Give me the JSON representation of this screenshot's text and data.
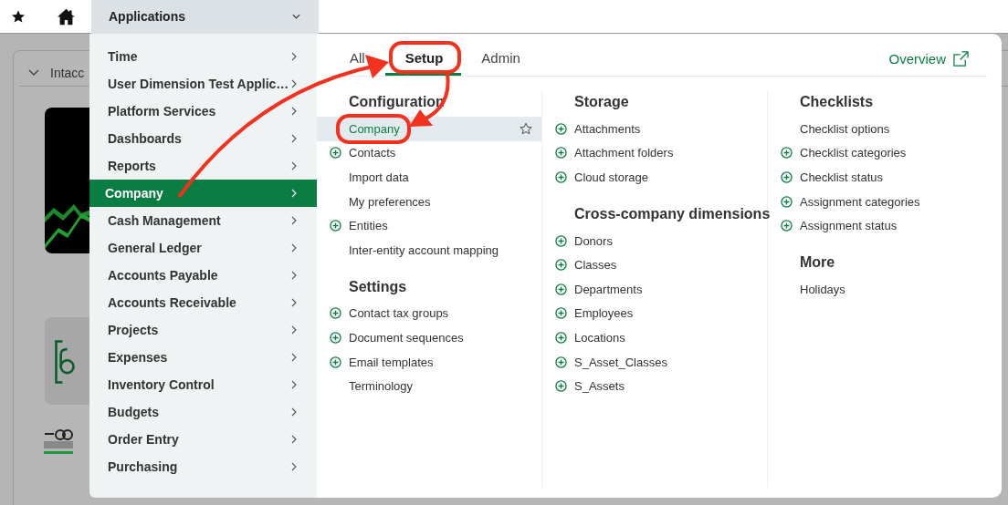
{
  "topbar": {
    "app_menu": "Applications"
  },
  "background": {
    "card_title": "Intacc"
  },
  "app_menu": [
    {
      "label": "Time",
      "selected": false
    },
    {
      "label": "User Dimension Test Applic…",
      "selected": false
    },
    {
      "label": "Platform Services",
      "selected": false
    },
    {
      "label": "Dashboards",
      "selected": false
    },
    {
      "label": "Reports",
      "selected": false
    },
    {
      "label": "Company",
      "selected": true
    },
    {
      "label": "Cash Management",
      "selected": false
    },
    {
      "label": "General Ledger",
      "selected": false
    },
    {
      "label": "Accounts Payable",
      "selected": false
    },
    {
      "label": "Accounts Receivable",
      "selected": false
    },
    {
      "label": "Projects",
      "selected": false
    },
    {
      "label": "Expenses",
      "selected": false
    },
    {
      "label": "Inventory Control",
      "selected": false
    },
    {
      "label": "Budgets",
      "selected": false
    },
    {
      "label": "Order Entry",
      "selected": false
    },
    {
      "label": "Purchasing",
      "selected": false
    }
  ],
  "panel": {
    "tabs": [
      {
        "label": "All",
        "selected": false
      },
      {
        "label": "Setup",
        "selected": true
      },
      {
        "label": "Admin",
        "selected": false
      }
    ],
    "overview_link": "Overview",
    "columns": [
      {
        "sections": [
          {
            "heading": "Configuration",
            "items": [
              {
                "label": "Company",
                "add": false,
                "selected": true
              },
              {
                "label": "Contacts",
                "add": true,
                "selected": false
              },
              {
                "label": "Import data",
                "add": false,
                "selected": false
              },
              {
                "label": "My preferences",
                "add": false,
                "selected": false
              },
              {
                "label": "Entities",
                "add": true,
                "selected": false
              },
              {
                "label": "Inter-entity account mapping",
                "add": false,
                "selected": false
              }
            ]
          },
          {
            "heading": "Settings",
            "items": [
              {
                "label": "Contact tax groups",
                "add": true,
                "selected": false
              },
              {
                "label": "Document sequences",
                "add": true,
                "selected": false
              },
              {
                "label": "Email templates",
                "add": true,
                "selected": false
              },
              {
                "label": "Terminology",
                "add": false,
                "selected": false
              }
            ]
          }
        ]
      },
      {
        "sections": [
          {
            "heading": "Storage",
            "items": [
              {
                "label": "Attachments",
                "add": true,
                "selected": false
              },
              {
                "label": "Attachment folders",
                "add": true,
                "selected": false
              },
              {
                "label": "Cloud storage",
                "add": true,
                "selected": false
              }
            ]
          },
          {
            "heading": "Cross-company dimensions",
            "items": [
              {
                "label": "Donors",
                "add": true,
                "selected": false
              },
              {
                "label": "Classes",
                "add": true,
                "selected": false
              },
              {
                "label": "Departments",
                "add": true,
                "selected": false
              },
              {
                "label": "Employees",
                "add": true,
                "selected": false
              },
              {
                "label": "Locations",
                "add": true,
                "selected": false
              },
              {
                "label": "S_Asset_Classes",
                "add": true,
                "selected": false
              },
              {
                "label": "S_Assets",
                "add": true,
                "selected": false
              }
            ]
          }
        ]
      },
      {
        "sections": [
          {
            "heading": "Checklists",
            "items": [
              {
                "label": "Checklist options",
                "add": false,
                "selected": false
              },
              {
                "label": "Checklist categories",
                "add": true,
                "selected": false
              },
              {
                "label": "Checklist status",
                "add": true,
                "selected": false
              },
              {
                "label": "Assignment categories",
                "add": true,
                "selected": false
              },
              {
                "label": "Assignment status",
                "add": true,
                "selected": false
              }
            ]
          },
          {
            "heading": "More",
            "items": [
              {
                "label": "Holidays",
                "add": false,
                "selected": false
              }
            ]
          }
        ]
      }
    ]
  }
}
